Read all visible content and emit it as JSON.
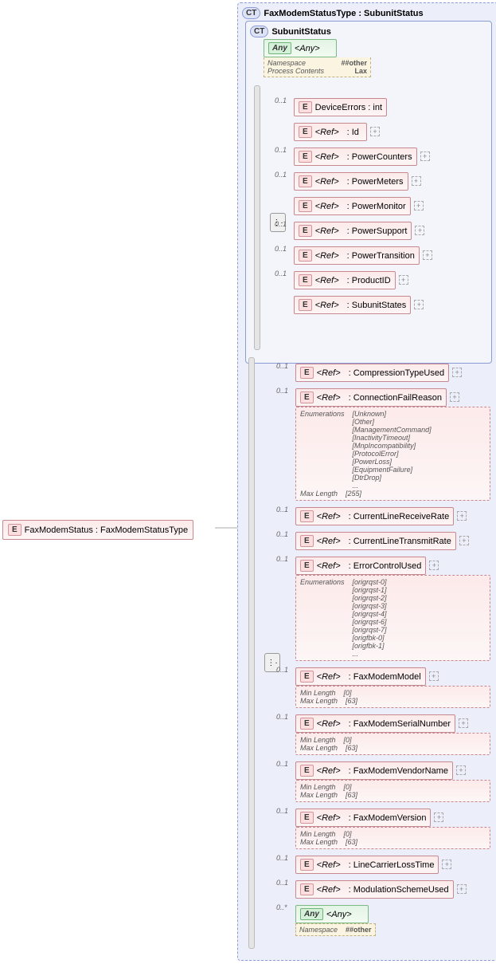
{
  "root": {
    "name": "FaxModemStatus : FaxModemStatusType"
  },
  "complexType": {
    "title": "FaxModemStatusType : SubunitStatus"
  },
  "subunitStatus": {
    "title": "SubunitStatus"
  },
  "any_label": "<Any>",
  "ref_label": "<Ref>",
  "badges": {
    "E": "E",
    "CT": "CT",
    "Any": "Any"
  },
  "any_props": {
    "ns_label": "Namespace",
    "ns_val": "##other",
    "pc_label": "Process Contents",
    "pc_val": "Lax"
  },
  "any_bottom_props": {
    "ns_label": "Namespace",
    "ns_val": "##other"
  },
  "compositorGlyph": "⋮·",
  "plus": "+",
  "occ": {
    "opt1": "0..1",
    "optN": "0..*"
  },
  "subunit_elements": [
    {
      "name": "DeviceErrors : int",
      "occ": "0..1",
      "plus": false
    },
    {
      "name": ": Id",
      "occ": "",
      "plus": true
    },
    {
      "name": ": PowerCounters",
      "occ": "0..1",
      "plus": true
    },
    {
      "name": ": PowerMeters",
      "occ": "0..1",
      "plus": true
    },
    {
      "name": ": PowerMonitor",
      "occ": "",
      "plus": true
    },
    {
      "name": ": PowerSupport",
      "occ": "0..1",
      "plus": true
    },
    {
      "name": ": PowerTransition",
      "occ": "0..1",
      "plus": true
    },
    {
      "name": ": ProductID",
      "occ": "0..1",
      "plus": true
    },
    {
      "name": ": SubunitStates",
      "occ": "",
      "plus": true
    }
  ],
  "fax_elements": [
    {
      "name": ": CompressionTypeUsed",
      "occ": "0..1",
      "plus": true
    },
    {
      "name": ": ConnectionFailReason",
      "occ": "0..1",
      "plus": true,
      "enums_label": "Enumerations",
      "enums": [
        "[Unknown]",
        "[Other]",
        "[ManagementCommand]",
        "[InactivityTimeout]",
        "[MnpIncompatibility]",
        "[ProtocolError]",
        "[PowerLoss]",
        "[EquipmentFailure]",
        "[DtrDrop]",
        "..."
      ],
      "maxlen_label": "Max Length",
      "maxlen": "[255]"
    },
    {
      "name": ": CurrentLineReceiveRate",
      "occ": "0..1",
      "plus": true
    },
    {
      "name": ": CurrentLineTransmitRate",
      "occ": "0..1",
      "plus": true
    },
    {
      "name": ": ErrorControlUsed",
      "occ": "0..1",
      "plus": true,
      "enums_label": "Enumerations",
      "enums": [
        "[origrqst-0]",
        "[origrqst-1]",
        "[origrqst-2]",
        "[origrqst-3]",
        "[origrqst-4]",
        "[origrqst-6]",
        "[origrqst-7]",
        "[origfbk-0]",
        "[origfbk-1]",
        "..."
      ]
    },
    {
      "name": ": FaxModemModel",
      "occ": "0..1",
      "plus": true,
      "minlen_label": "Min Length",
      "minlen": "[0]",
      "maxlen_label": "Max Length",
      "maxlen": "[63]"
    },
    {
      "name": ": FaxModemSerialNumber",
      "occ": "0..1",
      "plus": true,
      "minlen_label": "Min Length",
      "minlen": "[0]",
      "maxlen_label": "Max Length",
      "maxlen": "[63]"
    },
    {
      "name": ": FaxModemVendorName",
      "occ": "0..1",
      "plus": true,
      "minlen_label": "Min Length",
      "minlen": "[0]",
      "maxlen_label": "Max Length",
      "maxlen": "[63]"
    },
    {
      "name": ": FaxModemVersion",
      "occ": "0..1",
      "plus": true,
      "minlen_label": "Min Length",
      "minlen": "[0]",
      "maxlen_label": "Max Length",
      "maxlen": "[63]"
    },
    {
      "name": ": LineCarrierLossTime",
      "occ": "0..1",
      "plus": true
    },
    {
      "name": ": ModulationSchemeUsed",
      "occ": "0..1",
      "plus": true
    }
  ],
  "any_bottom_occ": "0..*"
}
